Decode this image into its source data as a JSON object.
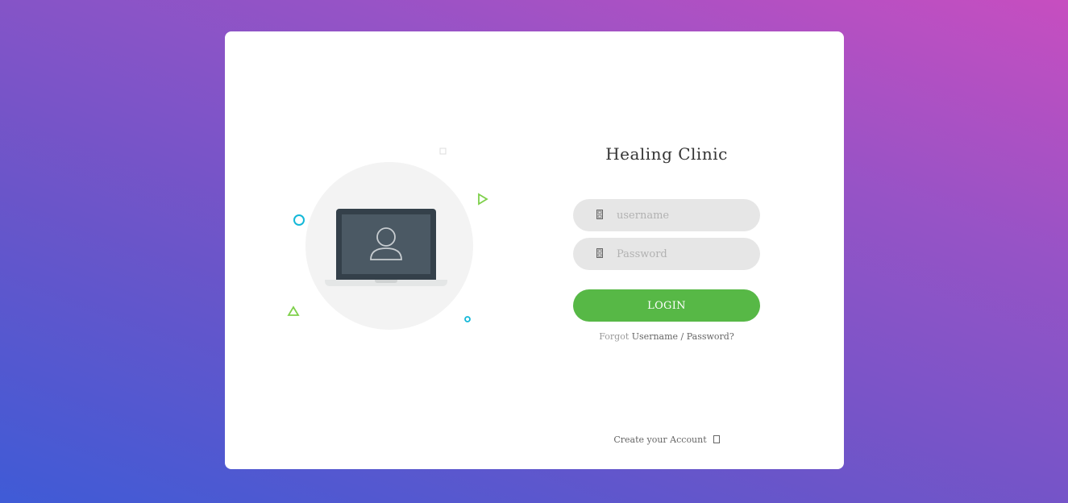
{
  "colors": {
    "accent_green": "#57b846",
    "deco_cyan": "#14b8d8",
    "deco_green": "#7ed04b"
  },
  "illustration": {
    "icons": [
      "laptop-icon",
      "user-icon"
    ]
  },
  "form": {
    "title": "Healing Clinic",
    "username": {
      "placeholder": "username",
      "value": "",
      "icon": "user-field-icon"
    },
    "password": {
      "placeholder": "Password",
      "value": "",
      "icon": "lock-field-icon"
    },
    "login_label": "LOGIN",
    "forgot_prefix": "Forgot",
    "forgot_link": "Username / Password?",
    "create_account": "Create your Account",
    "create_icon": "arrow-right-icon"
  }
}
